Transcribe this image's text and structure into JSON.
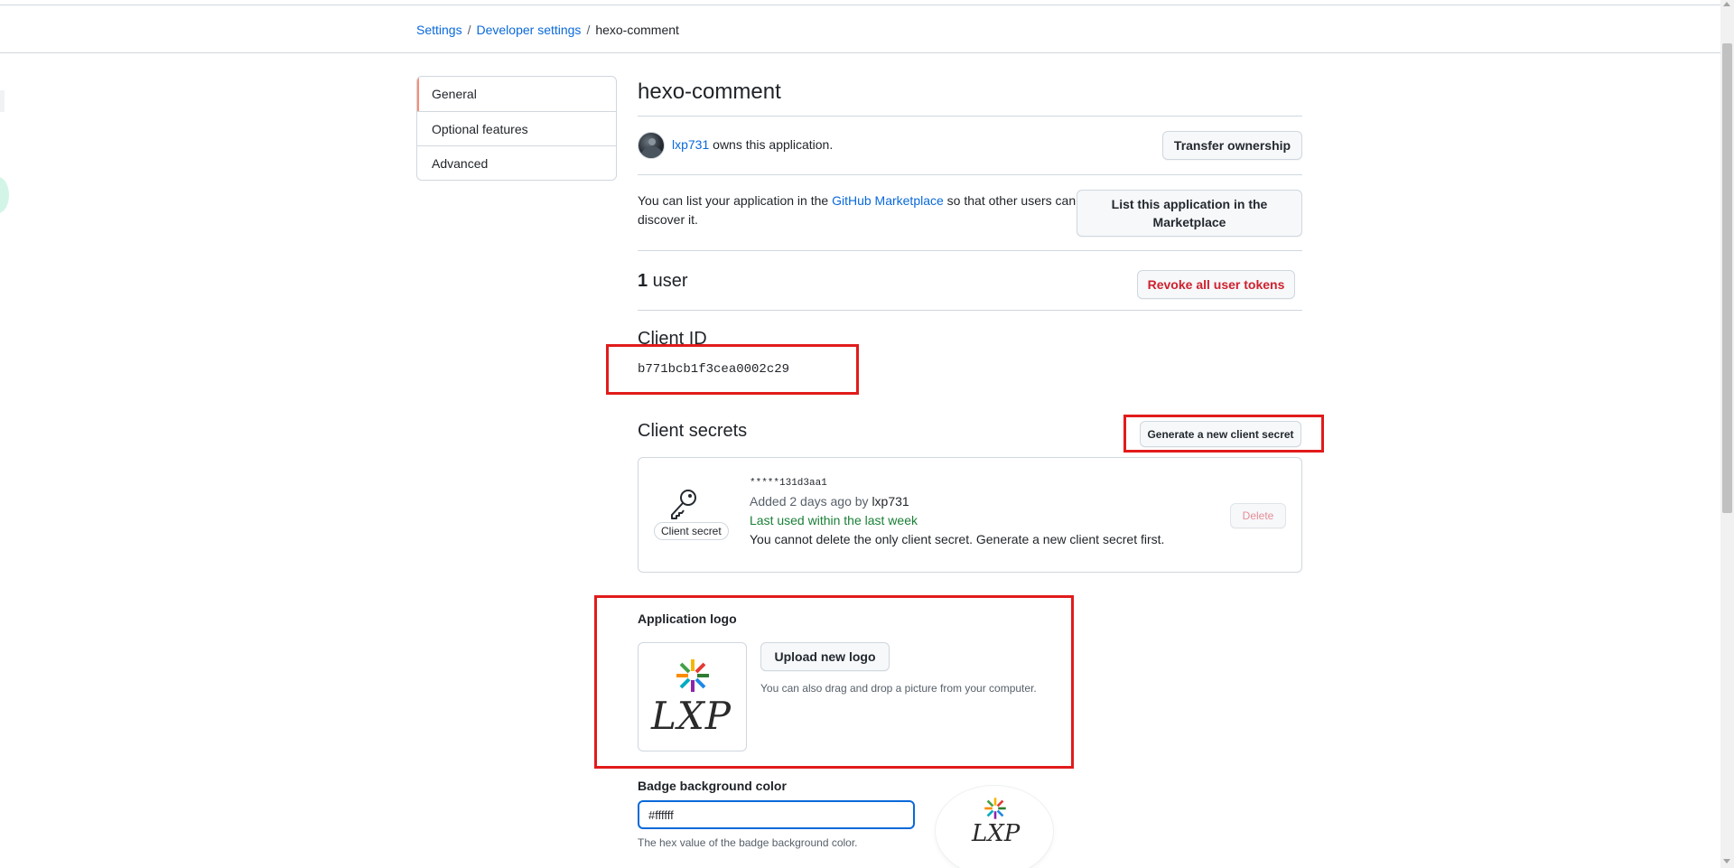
{
  "breadcrumb": {
    "settings": "Settings",
    "sep1": "/",
    "developer_settings": "Developer settings",
    "sep2": "/",
    "current": "hexo-comment"
  },
  "menu": {
    "items": [
      {
        "label": "General",
        "active": true
      },
      {
        "label": "Optional features",
        "active": false
      },
      {
        "label": "Advanced",
        "active": false
      }
    ]
  },
  "app": {
    "title": "hexo-comment",
    "owner": "lxp731",
    "owner_suffix": " owns this application.",
    "transfer_label": "Transfer ownership"
  },
  "marketplace": {
    "text_before": "You can list your application in the ",
    "link": "GitHub Marketplace",
    "text_after": " so that other users can discover it.",
    "button_label": "List this application in the Marketplace"
  },
  "users": {
    "count": "1",
    "label": " user",
    "revoke_label": "Revoke all user tokens"
  },
  "client_id": {
    "label": "Client ID",
    "value": "b771bcb1f3cea0002c29"
  },
  "client_secrets": {
    "title": "Client secrets",
    "generate_label": "Generate a new client secret",
    "pill": "Client secret",
    "hash": "*****131d3aa1",
    "added_prefix": "Added 2 days ago by ",
    "added_by": "lxp731",
    "last_used": "Last used within the last week",
    "note": "You cannot delete the only client secret. Generate a new client secret first.",
    "delete_label": "Delete"
  },
  "logo": {
    "label": "Application logo",
    "upload_label": "Upload new logo",
    "hint": "You can also drag and drop a picture from your computer.",
    "logo_text": "LXP"
  },
  "badge": {
    "label": "Badge background color",
    "value": "#ffffff",
    "hint": "The hex value of the badge background color.",
    "logo_text": "LXP"
  },
  "colors": {
    "link": "#0969da",
    "danger": "#cf222e",
    "success": "#1a7f37",
    "highlight": "#e11b1b",
    "menu_active": "#fd8c73"
  },
  "icons": [
    "key-icon",
    "avatar",
    "lxp-logo"
  ]
}
